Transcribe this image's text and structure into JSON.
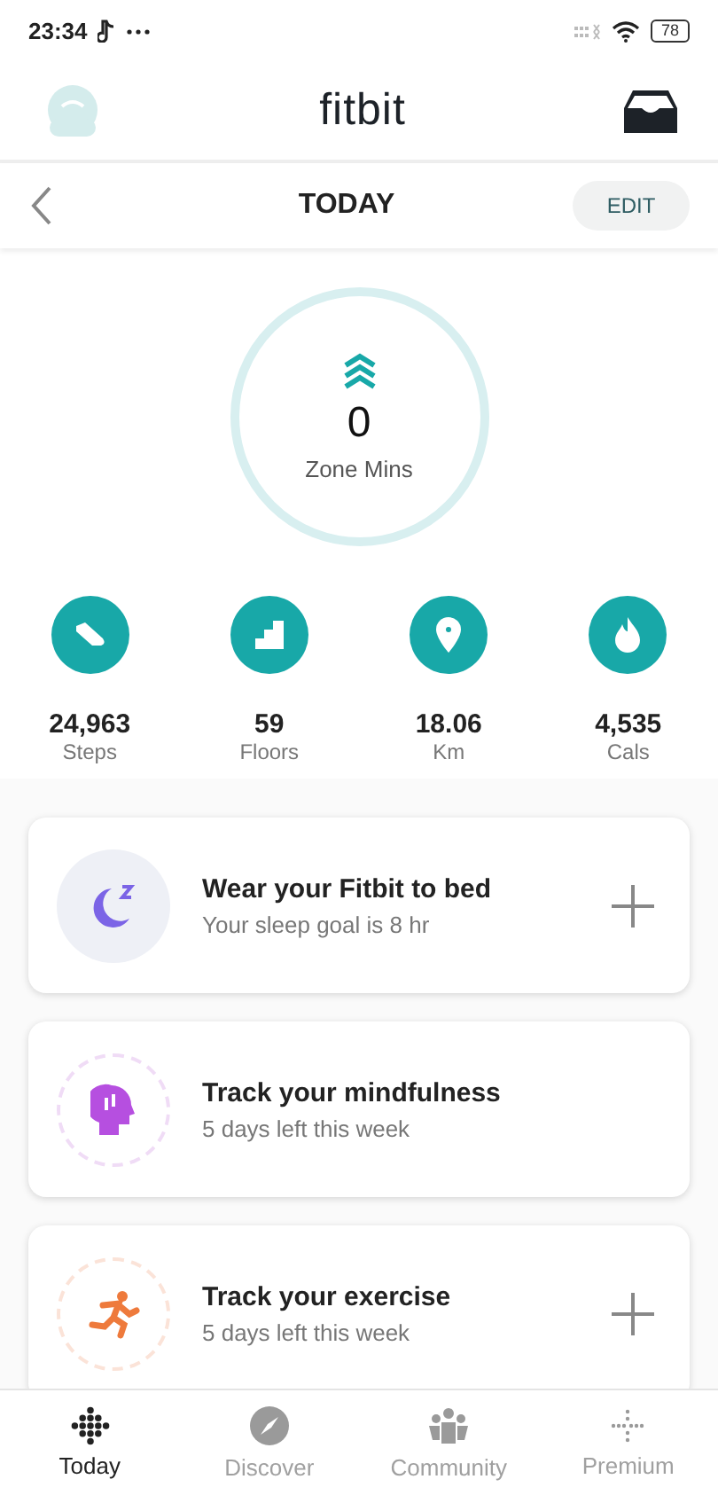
{
  "status_bar": {
    "time": "23:34",
    "battery": "78"
  },
  "header": {
    "title": "fitbit"
  },
  "date_bar": {
    "title": "TODAY",
    "edit_label": "EDIT"
  },
  "zone": {
    "value": "0",
    "label": "Zone Mins"
  },
  "stats": [
    {
      "kind": "steps",
      "value": "24,963",
      "label": "Steps"
    },
    {
      "kind": "floors",
      "value": "59",
      "label": "Floors"
    },
    {
      "kind": "distance",
      "value": "18.06",
      "label": "Km"
    },
    {
      "kind": "calories",
      "value": "4,535",
      "label": "Cals"
    }
  ],
  "cards": [
    {
      "kind": "sleep",
      "title": "Wear your Fitbit to bed",
      "subtitle": "Your sleep goal is 8 hr",
      "add_button": true
    },
    {
      "kind": "mindfulness",
      "title": "Track your mindfulness",
      "subtitle": "5 days left this week",
      "add_button": false
    },
    {
      "kind": "exercise",
      "title": "Track your exercise",
      "subtitle": "5 days left this week",
      "add_button": true
    }
  ],
  "nav": [
    {
      "kind": "today",
      "label": "Today",
      "selected": true
    },
    {
      "kind": "discover",
      "label": "Discover",
      "selected": false
    },
    {
      "kind": "community",
      "label": "Community",
      "selected": false
    },
    {
      "kind": "premium",
      "label": "Premium",
      "selected": false
    }
  ]
}
